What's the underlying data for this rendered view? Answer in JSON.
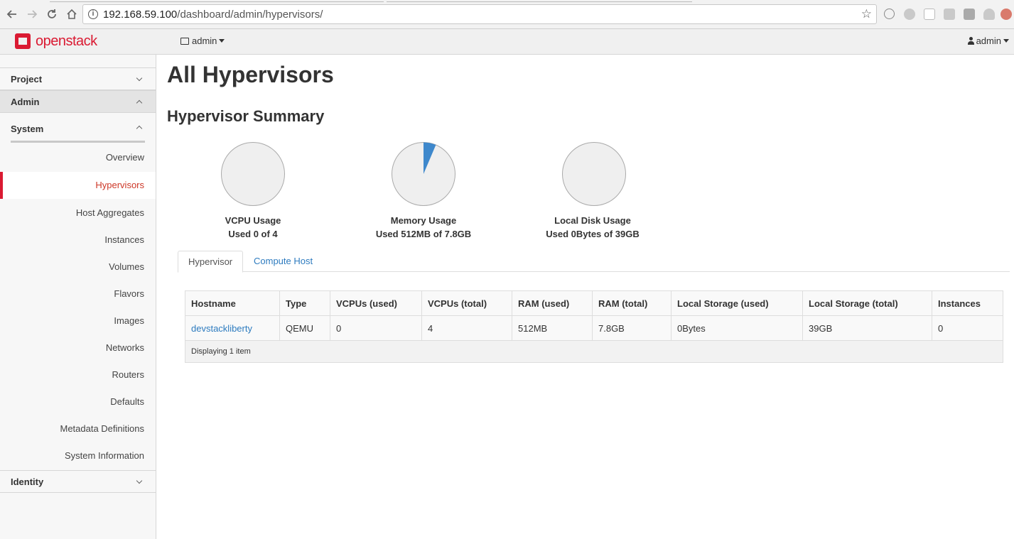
{
  "browser": {
    "url_host": "192.168.59.100",
    "url_path": "/dashboard/admin/hypervisors/"
  },
  "topnav": {
    "brand": "openstack",
    "project": "admin",
    "user": "admin"
  },
  "sidebar": {
    "project": "Project",
    "admin": "Admin",
    "system": "System",
    "items": [
      {
        "label": "Overview"
      },
      {
        "label": "Hypervisors"
      },
      {
        "label": "Host Aggregates"
      },
      {
        "label": "Instances"
      },
      {
        "label": "Volumes"
      },
      {
        "label": "Flavors"
      },
      {
        "label": "Images"
      },
      {
        "label": "Networks"
      },
      {
        "label": "Routers"
      },
      {
        "label": "Defaults"
      },
      {
        "label": "Metadata Definitions"
      },
      {
        "label": "System Information"
      }
    ],
    "identity": "Identity"
  },
  "page": {
    "title": "All Hypervisors",
    "summary_title": "Hypervisor Summary"
  },
  "usage": [
    {
      "title": "VCPU Usage",
      "text": "Used 0 of 4",
      "fraction": 0.0
    },
    {
      "title": "Memory Usage",
      "text": "Used 512MB of 7.8GB",
      "fraction": 0.064
    },
    {
      "title": "Local Disk Usage",
      "text": "Used 0Bytes of 39GB",
      "fraction": 0.0
    }
  ],
  "colors": {
    "accent": "#da1a32",
    "pie_fill": "#3e88cc",
    "pie_bg": "#efefef"
  },
  "tabs": [
    "Hypervisor",
    "Compute Host"
  ],
  "table": {
    "headers": [
      "Hostname",
      "Type",
      "VCPUs (used)",
      "VCPUs (total)",
      "RAM (used)",
      "RAM (total)",
      "Local Storage (used)",
      "Local Storage (total)",
      "Instances"
    ],
    "rows": [
      [
        "devstackliberty",
        "QEMU",
        "0",
        "4",
        "512MB",
        "7.8GB",
        "0Bytes",
        "39GB",
        "0"
      ]
    ],
    "footer": "Displaying 1 item"
  }
}
